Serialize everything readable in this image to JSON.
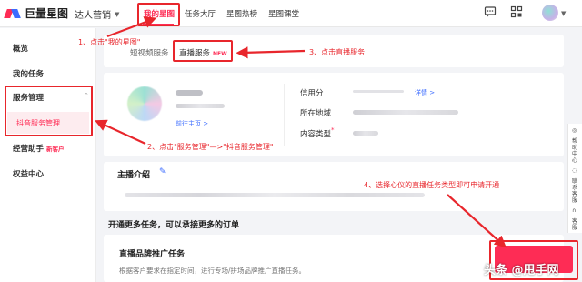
{
  "brand": {
    "logo_text": "巨量星图",
    "accent": "#fe2c55",
    "annotation_color": "#e8262c"
  },
  "topnav": {
    "account_dropdown": "达人营销",
    "items": [
      "我的星图",
      "任务大厅",
      "星图热榜",
      "星图课堂"
    ],
    "active_index": 0,
    "icons": [
      "message-icon",
      "qr-grid-icon",
      "avatar"
    ]
  },
  "sidebar": {
    "items": [
      "概览",
      "我的任务",
      "服务管理",
      "经营助手",
      "权益中心"
    ],
    "sub_items": [
      "抖音服务管理"
    ],
    "new_tag": "新客户"
  },
  "tabs": {
    "items": [
      "短视频服务",
      "直播服务"
    ],
    "new_badge": "NEW"
  },
  "profile": {
    "edit_link": "前往主页 >",
    "fields": [
      "信用分",
      "所在地域",
      "内容类型"
    ],
    "detail_link": "详情 >"
  },
  "anchor_intro": {
    "title": "主播介绍"
  },
  "more_tasks": {
    "title": "开通更多任务，可以承接更多的订单"
  },
  "live_task": {
    "title": "直播品牌推广任务",
    "description": "根据客户要求在指定时间，进行专场/拼场品牌推广直播任务。"
  },
  "right_float": [
    "帮助中心",
    "联系客服",
    "客服"
  ],
  "annotations": {
    "step1": "1、点击\"我的星图\"",
    "step2": "2、点击\"服务管理\"—>\"抖音服务管理\"",
    "step3": "3、点击直播服务",
    "step4": "4、选择心仪的直播任务类型即可申请开通"
  },
  "watermark": "头条 @甩手网"
}
